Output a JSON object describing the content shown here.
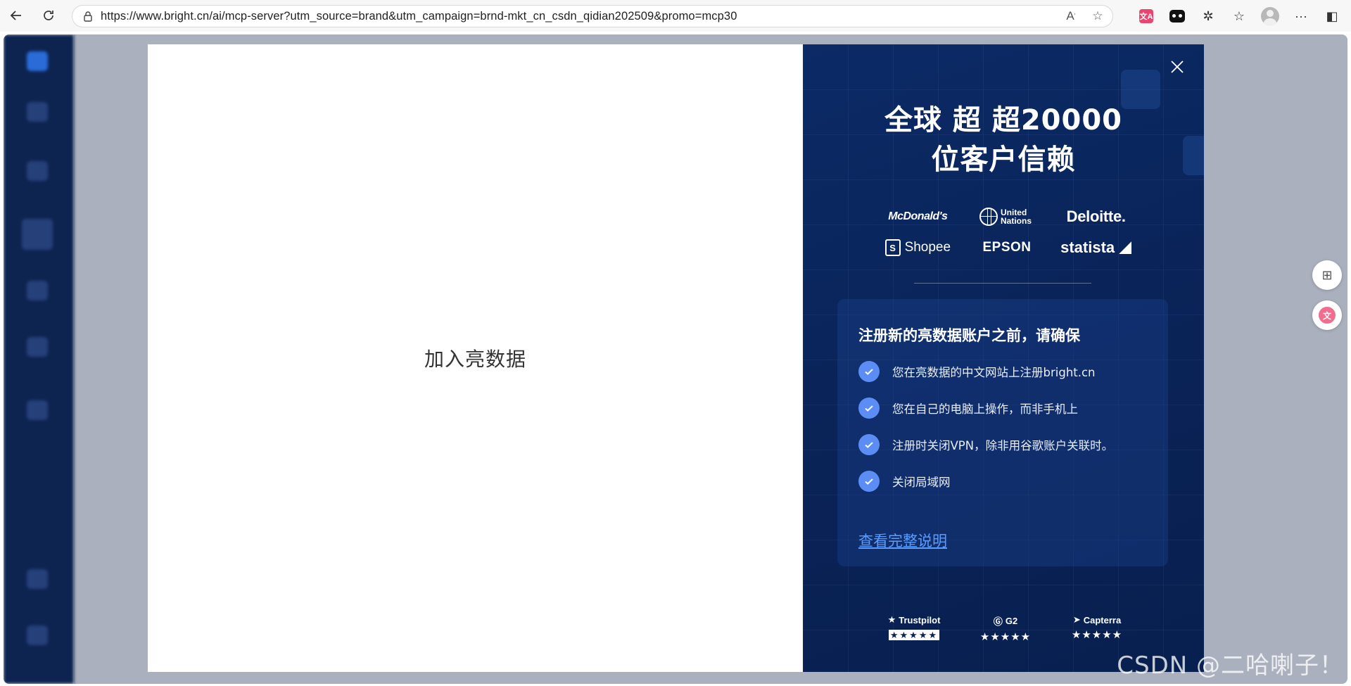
{
  "browser": {
    "url": "https://www.bright.cn/ai/mcp-server?utm_source=brand&utm_campaign=brnd-mkt_cn_csdn_qidian202509&promo=mcp30"
  },
  "modal": {
    "join_title": "加入亮数据",
    "headline_line1": "全球 超 超20000",
    "headline_line2": "位客户信赖",
    "logos": [
      "McDonald's",
      "United Nations",
      "Deloitte.",
      "Shopee",
      "EPSON",
      "statista"
    ],
    "card": {
      "title": "注册新的亮数据账户之前，请确保",
      "items": [
        "您在亮数据的中文网站上注册bright.cn",
        "您在自己的电脑上操作，而非手机上",
        "注册时关闭VPN，除非用谷歌账户关联时。",
        "关闭局域网"
      ],
      "link": "查看完整说明"
    },
    "ratings": [
      {
        "name": "Trustpilot",
        "stars": "★★★★★"
      },
      {
        "name": "G2",
        "stars": "★★★★★"
      },
      {
        "name": "Capterra",
        "stars": "★★★★★"
      }
    ]
  },
  "watermark": "CSDN @二哈喇子！",
  "colors": {
    "modal_bg": "#0a2357",
    "check": "#5b8df5",
    "link": "#5b9cff"
  }
}
